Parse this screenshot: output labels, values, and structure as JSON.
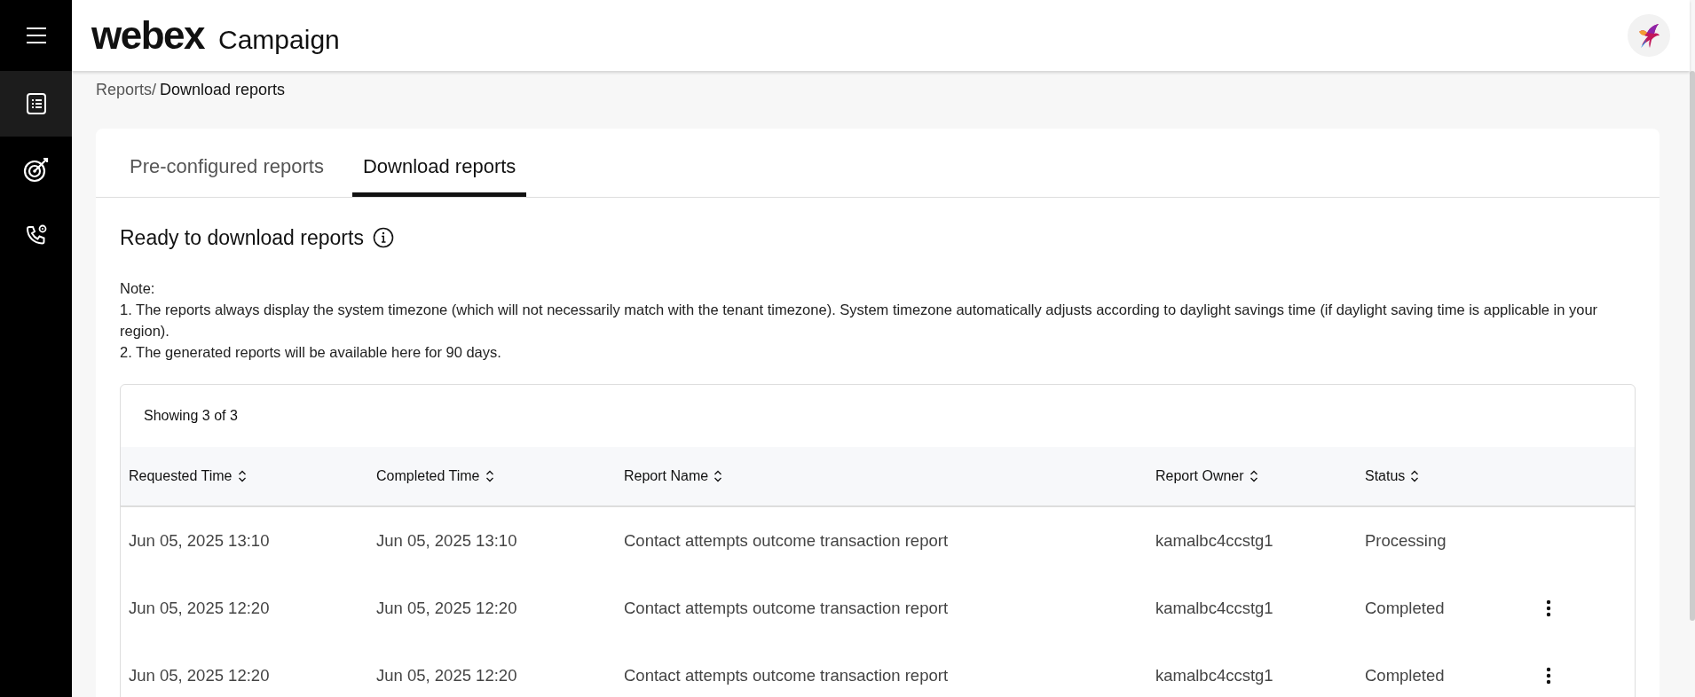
{
  "header": {
    "brand": "webex",
    "product": "Campaign"
  },
  "sidebar": {
    "items": [
      {
        "kind": "reports",
        "selected": true
      },
      {
        "kind": "target",
        "selected": false
      },
      {
        "kind": "phone",
        "selected": false
      }
    ]
  },
  "breadcrumb": {
    "parent": "Reports/",
    "current": "Download reports"
  },
  "tabs": [
    {
      "label": "Pre-configured reports",
      "selected": false
    },
    {
      "label": "Download reports",
      "selected": true
    }
  ],
  "section_title": "Ready to download reports",
  "note": [
    "Note:",
    "1. The reports always display the system timezone (which will not necessarily match with the tenant timezone). System timezone automatically adjusts according to daylight savings time (if daylight saving time is applicable in your region).",
    "2. The generated reports will be available here for 90 days."
  ],
  "table": {
    "count": "Showing 3 of 3",
    "columns": [
      "Requested Time",
      "Completed Time",
      "Report Name",
      "Report Owner",
      "Status"
    ],
    "rows": [
      {
        "cells": [
          "Jun 05, 2025 13:10",
          "Jun 05, 2025 13:10",
          "Contact attempts outcome transaction report",
          "kamalbc4ccstg1",
          "Processing"
        ],
        "menu": false
      },
      {
        "cells": [
          "Jun 05, 2025 12:20",
          "Jun 05, 2025 12:20",
          "Contact attempts outcome transaction report",
          "kamalbc4ccstg1",
          "Completed"
        ],
        "menu": true
      },
      {
        "cells": [
          "Jun 05, 2025 12:20",
          "Jun 05, 2025 12:20",
          "Contact attempts outcome transaction report",
          "kamalbc4ccstg1",
          "Completed"
        ],
        "menu": true
      }
    ]
  }
}
